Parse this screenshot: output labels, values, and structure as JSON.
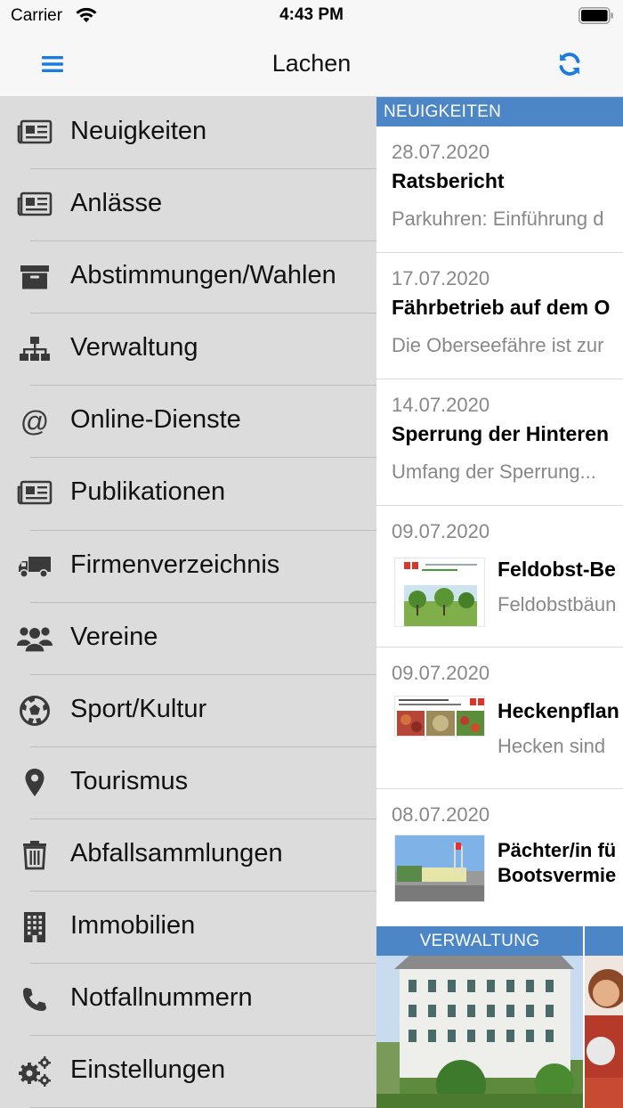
{
  "status_bar": {
    "carrier": "Carrier",
    "time": "4:43 PM"
  },
  "nav": {
    "title": "Lachen"
  },
  "colors": {
    "accent": "#1a7be0",
    "section_header": "#4c86c6",
    "sidebar_bg": "#dcdcdc"
  },
  "sidebar": {
    "items": [
      {
        "label": "Neuigkeiten",
        "icon": "newspaper-icon"
      },
      {
        "label": "Anlässe",
        "icon": "newspaper-icon"
      },
      {
        "label": "Abstimmungen/Wahlen",
        "icon": "archive-box-icon"
      },
      {
        "label": "Verwaltung",
        "icon": "org-chart-icon"
      },
      {
        "label": "Online-Dienste",
        "icon": "at-sign-icon"
      },
      {
        "label": "Publikationen",
        "icon": "newspaper-icon"
      },
      {
        "label": "Firmenverzeichnis",
        "icon": "truck-icon"
      },
      {
        "label": "Vereine",
        "icon": "users-icon"
      },
      {
        "label": "Sport/Kultur",
        "icon": "soccer-ball-icon"
      },
      {
        "label": "Tourismus",
        "icon": "map-pin-icon"
      },
      {
        "label": "Abfallsammlungen",
        "icon": "trash-icon"
      },
      {
        "label": "Immobilien",
        "icon": "building-icon"
      },
      {
        "label": "Notfallnummern",
        "icon": "phone-icon"
      },
      {
        "label": "Einstellungen",
        "icon": "gears-icon"
      }
    ]
  },
  "content": {
    "section_title": "NEUIGKEITEN",
    "news": [
      {
        "date": "28.07.2020",
        "headline": "Ratsbericht",
        "teaser": "Parkuhren: Einführung d"
      },
      {
        "date": "17.07.2020",
        "headline": "Fährbetrieb auf dem O",
        "teaser": "Die Oberseefähre ist zur"
      },
      {
        "date": "14.07.2020",
        "headline": "Sperrung der Hinteren",
        "teaser": "Umfang der Sperrung..."
      },
      {
        "date": "09.07.2020",
        "headline": "Feldobst-Be",
        "teaser": "Feldobstbäun"
      },
      {
        "date": "09.07.2020",
        "headline": "Heckenpflan",
        "teaser": "Hecken sind"
      },
      {
        "date": "08.07.2020",
        "headline_line1": "Pächter/in fü",
        "headline_line2": "Bootsvermie",
        "teaser": ""
      }
    ],
    "tiles": [
      {
        "label": "VERWALTUNG"
      }
    ]
  }
}
